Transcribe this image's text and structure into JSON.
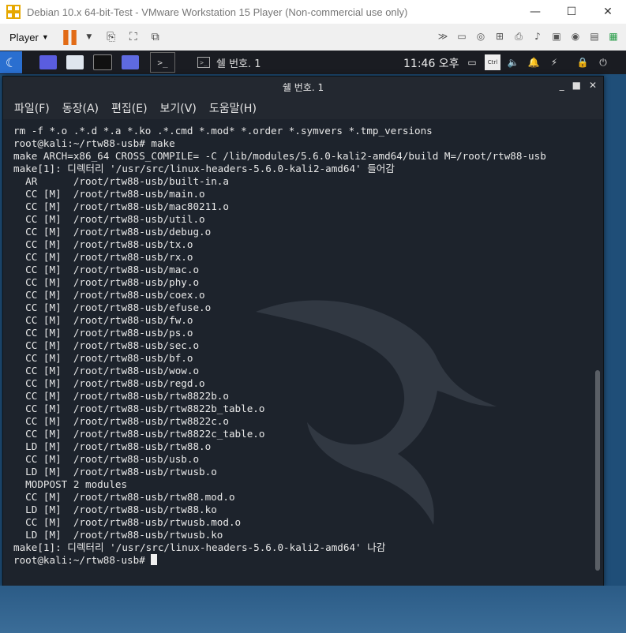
{
  "vm": {
    "window_title": "Debian 10.x 64-bit-Test - VMware Workstation 15 Player (Non-commercial use only)",
    "player_label": "Player",
    "minimize": "—",
    "maximize": "☐",
    "close": "✕"
  },
  "kali_panel": {
    "task_title": "쉘 번호. 1",
    "clock": "11:46 오후"
  },
  "terminal": {
    "title": "쉘 번호. 1",
    "menu": [
      "파일(F)",
      "동장(A)",
      "편집(E)",
      "보기(V)",
      "도움말(H)"
    ],
    "prompt": "root@kali:~/rtw88-usb# ",
    "lines": [
      "rm -f *.o .*.d *.a *.ko .*.cmd *.mod* *.order *.symvers *.tmp_versions",
      "root@kali:~/rtw88-usb# make",
      "make ARCH=x86_64 CROSS_COMPILE= -C /lib/modules/5.6.0-kali2-amd64/build M=/root/rtw88-usb",
      "make[1]: 디렉터리 '/usr/src/linux-headers-5.6.0-kali2-amd64' 들어감",
      "  AR      /root/rtw88-usb/built-in.a",
      "  CC [M]  /root/rtw88-usb/main.o",
      "  CC [M]  /root/rtw88-usb/mac80211.o",
      "  CC [M]  /root/rtw88-usb/util.o",
      "  CC [M]  /root/rtw88-usb/debug.o",
      "  CC [M]  /root/rtw88-usb/tx.o",
      "  CC [M]  /root/rtw88-usb/rx.o",
      "  CC [M]  /root/rtw88-usb/mac.o",
      "  CC [M]  /root/rtw88-usb/phy.o",
      "  CC [M]  /root/rtw88-usb/coex.o",
      "  CC [M]  /root/rtw88-usb/efuse.o",
      "  CC [M]  /root/rtw88-usb/fw.o",
      "  CC [M]  /root/rtw88-usb/ps.o",
      "  CC [M]  /root/rtw88-usb/sec.o",
      "  CC [M]  /root/rtw88-usb/bf.o",
      "  CC [M]  /root/rtw88-usb/wow.o",
      "  CC [M]  /root/rtw88-usb/regd.o",
      "  CC [M]  /root/rtw88-usb/rtw8822b.o",
      "  CC [M]  /root/rtw88-usb/rtw8822b_table.o",
      "  CC [M]  /root/rtw88-usb/rtw8822c.o",
      "  CC [M]  /root/rtw88-usb/rtw8822c_table.o",
      "  LD [M]  /root/rtw88-usb/rtw88.o",
      "  CC [M]  /root/rtw88-usb/usb.o",
      "  LD [M]  /root/rtw88-usb/rtwusb.o",
      "  MODPOST 2 modules",
      "  CC [M]  /root/rtw88-usb/rtw88.mod.o",
      "  LD [M]  /root/rtw88-usb/rtw88.ko",
      "  CC [M]  /root/rtw88-usb/rtwusb.mod.o",
      "  LD [M]  /root/rtw88-usb/rtwusb.ko",
      "make[1]: 디렉터리 '/usr/src/linux-headers-5.6.0-kali2-amd64' 나감"
    ]
  }
}
